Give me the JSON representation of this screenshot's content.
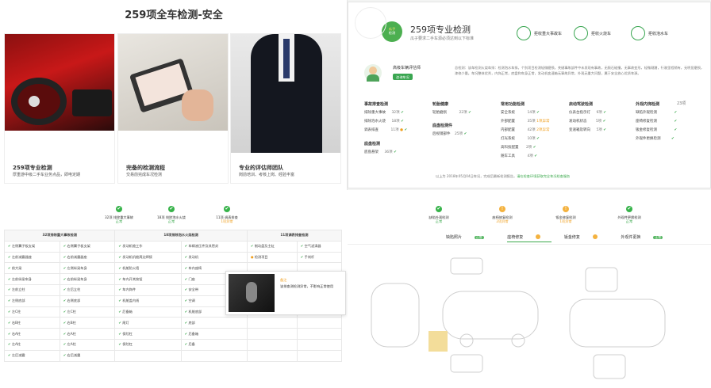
{
  "tl": {
    "title": "259项全车检测-安全",
    "cards": [
      {
        "title": "259项专业检测",
        "desc": "厚重游中级二手车业务点品，即电定期"
      },
      {
        "title": "完备的检测流程",
        "desc": "交易前完成车况检测"
      },
      {
        "title": "专业的评估师团队",
        "desc": "岗前培训、考核上岗、经验丰富"
      }
    ]
  },
  "tr": {
    "logo_top": "瓜子",
    "logo_bottom": "检测",
    "title": "259项专业检测",
    "subtitle": "瓜子要求二手车源必须达到以下标准",
    "headers": [
      "拒收重大事故车",
      "拒收火烧车",
      "拒收泡水车"
    ],
    "assessor_label": "高级车辆评估师",
    "call_label": "咨询车况",
    "summary": "总检测：该车检测火烧车排：检测泡水车排。个别项目检测轻微磨损，关键事故部件中未发现有事故，无陨石碰撞，无事故变形，轻微剐蹭，行驶里程稍有，无明显磨损，漆修少量。车况整体优秀，内饰正常，底盘和车身正常，发动机变速箱无事故异常，外观无重大问题，属于安全放心优质车源。",
    "columns": [
      {
        "title": "事故排查检测",
        "rows": [
          {
            "label": "排除重大事故",
            "count": "32项"
          },
          {
            "label": "排除泡水火烧",
            "count": "18项"
          },
          {
            "label": "调表排查",
            "count": "11项"
          }
        ],
        "extra_title": "底盘检测",
        "extra_rows": [
          {
            "label": "底盘悬架",
            "count": "36项"
          }
        ]
      },
      {
        "title": "轮胎健康",
        "rows": [
          {
            "label": "轮胎磨损",
            "count": "22项"
          }
        ],
        "extra_title": "后视镜检测",
        "extra_rows": [
          {
            "label": "后视镜部件",
            "count": "25项"
          }
        ],
        "extra_label": "底盘检测件"
      },
      {
        "title": "常用功能检测",
        "rows": [
          {
            "label": "安全系统",
            "count": "14项"
          },
          {
            "label": "外部配置",
            "count": "35项",
            "note": "1项异常"
          },
          {
            "label": "内部配置",
            "count": "42项",
            "note": "2项异常"
          },
          {
            "label": "灯光系统",
            "count": "10项"
          },
          {
            "label": "高科技配置",
            "count": "2项"
          },
          {
            "label": "随车工具",
            "count": "4项"
          }
        ]
      },
      {
        "title": "启动驾驶检测",
        "rows": [
          {
            "label": "仪表台指示灯",
            "count": "9项"
          },
          {
            "label": "发动机状态",
            "count": "5项"
          },
          {
            "label": "变速箱及转向",
            "count": "5项"
          }
        ]
      },
      {
        "title": "外观内饰检测",
        "count": "23项",
        "rows": [
          {
            "label": "缺陷外观检测"
          },
          {
            "label": "座椅修复检测"
          },
          {
            "label": "钣金修复检测"
          },
          {
            "label": "外观件更换检测"
          }
        ]
      }
    ],
    "footer_prefix": "以上为 2018年05月04日车况，完成后最新检测报告，",
    "footer_link": "请在检查环境获取完全车况检查服务"
  },
  "bl": {
    "summary": [
      {
        "label": "32项 排除重大事故",
        "state": "正常"
      },
      {
        "label": "18项 排除泡水火烧",
        "state": "正常"
      },
      {
        "label": "11项 调表排查",
        "state": "1项异常"
      }
    ],
    "table_headers": [
      "32项排除重大事故检测",
      "18项排除泡水火烧检测",
      "11项调表排查检测"
    ],
    "rows": [
      [
        "左侧翼子板支架",
        "右侧翼子板支架",
        "发动机舱工作",
        "车辆液压件及其密封",
        "制动盘及主缸",
        "空气滤清器"
      ],
      [
        "左前减震器座",
        "右前减震器座",
        "发动机机舱周边焊接",
        "发动机",
        "检测项目",
        "手刹杆"
      ],
      [
        "前大梁",
        "左侧纵梁车身",
        "机舱防火墙",
        "车内座椅",
        "",
        ""
      ],
      [
        "左前纵梁车身",
        "右前纵梁车身",
        "车内开关按钮",
        "门座",
        "",
        ""
      ],
      [
        "左前立柱",
        "左后立柱",
        "车内饰件",
        "安全带",
        "",
        ""
      ],
      [
        "左侧底部",
        "右侧底部",
        "机舱盖内线",
        "空调",
        "",
        ""
      ],
      [
        "左C柱",
        "左C柱",
        "后备箱",
        "机舱底部",
        "OBD查询",
        "仪表"
      ],
      [
        "右B柱",
        "右B柱",
        "尾灯",
        "底部",
        "",
        ""
      ],
      [
        "右A柱",
        "右A柱",
        "保险杠",
        "后备箱",
        "",
        ""
      ],
      [
        "左A柱",
        "左A柱",
        "保险杠",
        "后备",
        "",
        ""
      ],
      [
        "左后减震",
        "右后减震",
        "",
        "",
        "",
        ""
      ]
    ],
    "popup_title": "备注",
    "popup_text": "该排查测检测异常，不影响正常使用",
    "popup_check": "前后翻车"
  },
  "br": {
    "summary": [
      {
        "label": "缺陷外观检测",
        "state": "正常"
      },
      {
        "label": "座椅修复检测",
        "state": "2项异常"
      },
      {
        "label": "钣金修复检测",
        "state": "1项异常"
      },
      {
        "label": "外观件更换检测",
        "state": "正常"
      }
    ],
    "tabs": [
      {
        "label": "缺陷照片",
        "badge": "正常"
      },
      {
        "label": "座椅修复",
        "badge": "2"
      },
      {
        "label": "钣金修复",
        "badge": "1"
      },
      {
        "label": "外观件更换",
        "badge": "正常"
      }
    ]
  },
  "colors": {
    "accent": "#39a84a",
    "warn": "#f4b23f"
  }
}
